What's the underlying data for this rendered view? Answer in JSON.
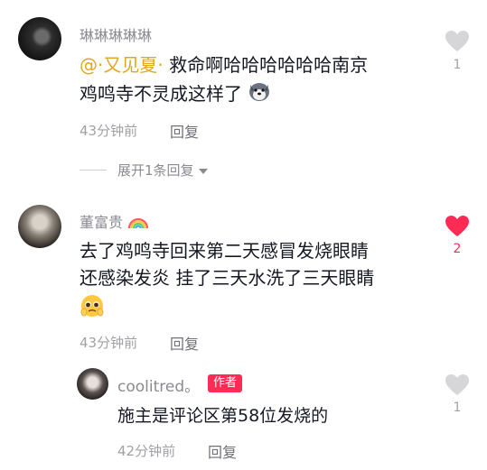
{
  "comments": [
    {
      "username": "琳琳琳琳琳",
      "mention": "@·又见夏·",
      "text_line1": " 救命啊哈哈哈哈哈哈南京",
      "text_line2": "鸡鸣寺不灵成这样了",
      "emoji": "dog-emoji",
      "time": "43分钟前",
      "reply_label": "回复",
      "like_count": "1",
      "liked": false,
      "expand_label": "展开1条回复"
    },
    {
      "username": "董富贵",
      "username_emoji": "rainbow-emoji",
      "text_line1": "去了鸡鸣寺回来第二天感冒发烧眼睛",
      "text_line2": "还感染发炎 挂了三天水洗了三天眼睛",
      "emoji": "pleading-face-emoji",
      "time": "43分钟前",
      "reply_label": "回复",
      "like_count": "2",
      "liked": true
    }
  ],
  "reply": {
    "username": "coolitred。",
    "author_tag": "作者",
    "text": "施主是评论区第58位发烧的",
    "time": "42分钟前",
    "reply_label": "回复",
    "like_count": "1",
    "liked": false
  },
  "colors": {
    "like_active": "#fe2c55",
    "like_inactive": "#d6d6d8",
    "mention": "#e0a81c"
  }
}
